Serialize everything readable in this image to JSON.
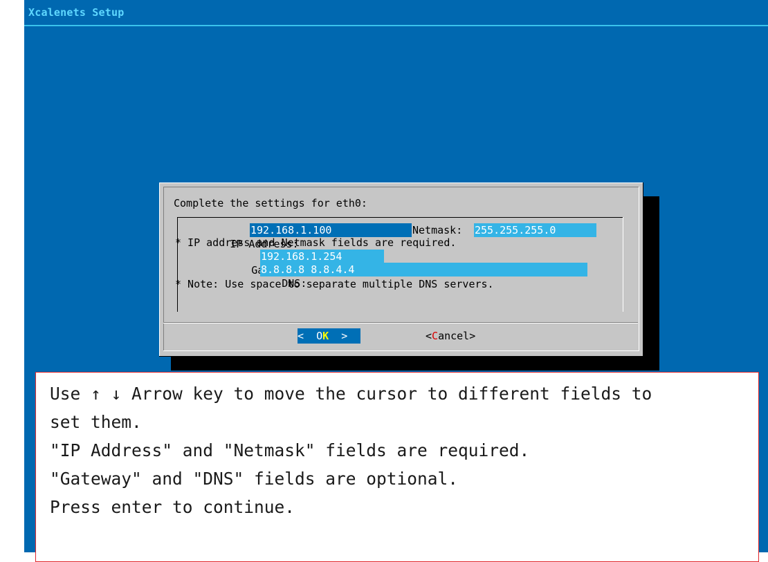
{
  "app": {
    "title": "Xcalenets Setup"
  },
  "dialog": {
    "prompt": "Complete the settings for eth0:",
    "fields": {
      "ip_label": "IP Address:",
      "ip_value": "192.168.1.100",
      "netmask_label": "Netmask:",
      "netmask_value": "255.255.255.0",
      "required_note": "* IP address and Netmask fields are required.",
      "gateway_label": "Gateway:",
      "gateway_value": "192.168.1.254",
      "dns_label": "DNS:",
      "dns_value": "8.8.8.8 8.8.4.4",
      "dns_note": "* Note: Use space to separate multiple DNS servers."
    },
    "buttons": {
      "ok_left": "<  ",
      "ok_hot": "O",
      "ok_hot2": "K",
      "ok_right": "  >",
      "cancel_left": "<",
      "cancel_hot": "C",
      "cancel_rest": "ancel>"
    }
  },
  "annotation": {
    "lines": [
      "Use ↑ ↓ Arrow key to move the cursor to different fields to",
      "set them.",
      "\"IP Address\" and \"Netmask\" fields are required.",
      "\"Gateway\" and \"DNS\" fields are optional.",
      "Press enter to continue."
    ]
  },
  "colors": {
    "screen_bg": "#0068b0",
    "dialog_bg": "#c6c6c6",
    "active_field": "#006fb6",
    "inactive_field": "#34b4e6",
    "title_text": "#5fd7ff",
    "hotkey_ok": "#ffff00",
    "hotkey_cancel": "#d70000",
    "annotation_border": "#e0262b"
  }
}
